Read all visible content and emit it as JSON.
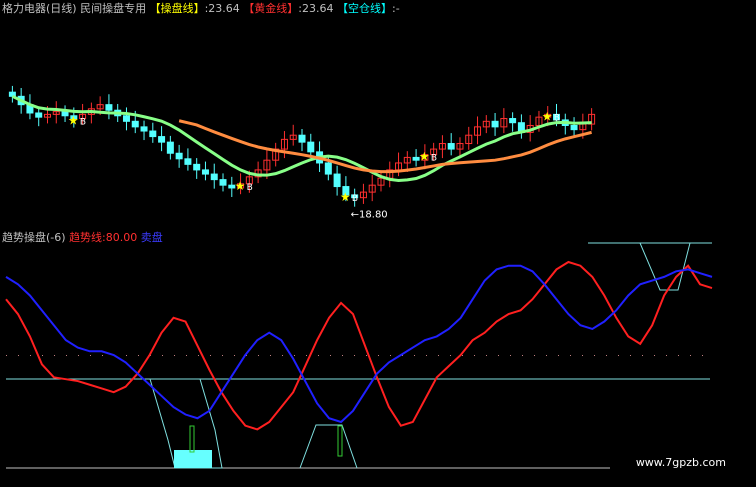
{
  "header": {
    "stock": "格力电器(日线)",
    "mode": "民间操盘专用",
    "line1_label": "【操盘线】",
    "line1_value": ":23.64",
    "line2_label": "【黄金线】",
    "line2_value": ":23.64",
    "line3_label": "【空仓线】",
    "line3_value": ":-"
  },
  "sub_header": {
    "title": "趋势操盘(-6)",
    "trend_label": "趋势线:",
    "trend_value": "80.00",
    "sell_label": "卖盘"
  },
  "watermark": "www.7gpzb.com",
  "colors": {
    "background": "#000000",
    "candle_up": "#ff3030",
    "candle_down": "#54ffff",
    "ma_green": "#88ff88",
    "ma_orange": "#ff8c40",
    "trend_red": "#ff2020",
    "trend_blue": "#2020ff",
    "band_cyan": "#7fe0e0",
    "signal_star": "#ffff00"
  },
  "chart_data": [
    {
      "type": "candlestick",
      "title": "格力电器(日线)",
      "annotation": "←18.80",
      "marker_labels": [
        "B",
        "B",
        "B",
        "B",
        "B",
        "B",
        "B",
        "B"
      ],
      "closes": [
        26.2,
        25.6,
        25.0,
        24.7,
        24.9,
        25.1,
        24.8,
        24.6,
        24.9,
        25.3,
        25.6,
        25.2,
        24.8,
        24.4,
        24.0,
        23.7,
        23.3,
        22.9,
        22.1,
        21.7,
        21.3,
        20.9,
        20.6,
        20.2,
        19.8,
        19.6,
        19.9,
        20.4,
        20.9,
        21.6,
        22.4,
        23.1,
        23.4,
        22.9,
        22.2,
        21.4,
        20.6,
        19.7,
        19.1,
        18.9,
        19.3,
        19.8,
        20.3,
        20.9,
        21.4,
        21.8,
        21.6,
        22.0,
        22.4,
        22.8,
        22.4,
        22.8,
        23.4,
        24.0,
        24.4,
        24.0,
        24.6,
        24.3,
        23.6,
        24.1,
        24.7,
        24.9,
        24.5,
        24.1,
        23.8,
        24.2,
        24.9
      ]
    },
    {
      "type": "line",
      "title": "趋势操盘(-6)",
      "series": [
        {
          "name": "趋势线",
          "values": [
            80,
            72,
            60,
            45,
            38,
            37,
            36,
            34,
            32,
            30,
            33,
            40,
            50,
            62,
            70,
            68,
            55,
            42,
            30,
            20,
            12,
            10,
            14,
            22,
            30,
            44,
            58,
            70,
            78,
            72,
            55,
            38,
            22,
            12,
            14,
            26,
            38,
            44,
            50,
            58,
            62,
            68,
            72,
            74,
            80,
            88,
            96,
            100,
            98,
            92,
            82,
            70,
            60,
            56,
            66,
            82,
            92,
            98,
            88,
            86
          ]
        },
        {
          "name": "卖盘",
          "values": [
            92,
            88,
            82,
            74,
            66,
            58,
            54,
            52,
            52,
            50,
            46,
            40,
            34,
            28,
            22,
            18,
            16,
            20,
            30,
            40,
            50,
            58,
            62,
            58,
            48,
            36,
            24,
            16,
            14,
            20,
            30,
            40,
            46,
            50,
            54,
            58,
            60,
            64,
            70,
            80,
            90,
            96,
            98,
            98,
            95,
            88,
            80,
            72,
            66,
            64,
            68,
            74,
            82,
            88,
            90,
            92,
            95,
            96,
            94,
            92
          ]
        }
      ]
    }
  ]
}
